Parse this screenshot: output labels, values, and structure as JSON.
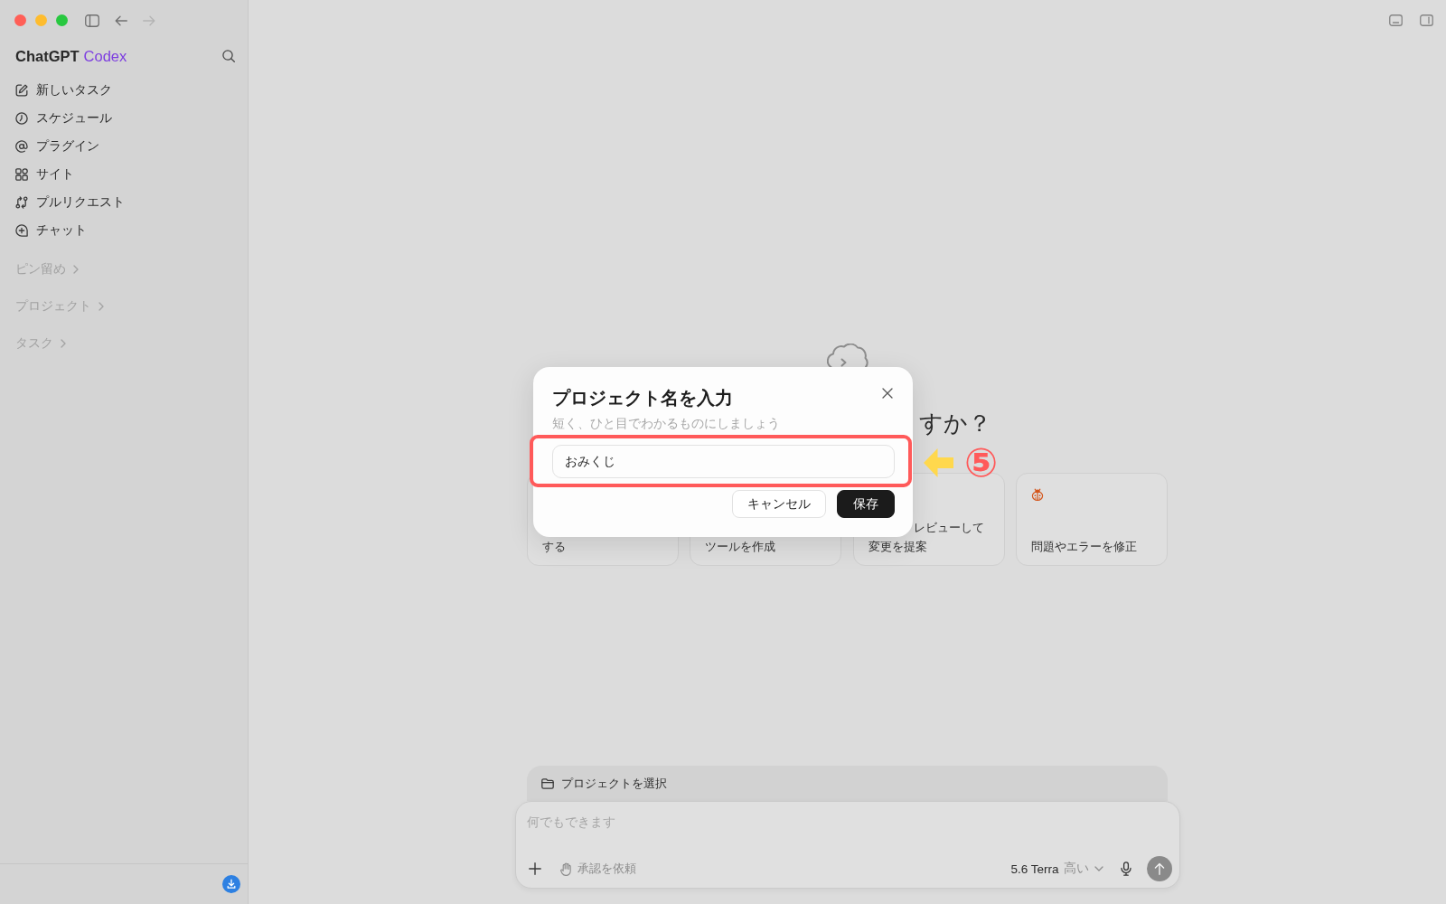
{
  "window": {
    "nav_buttons": [
      {
        "kind": "sidebar-toggle",
        "disabled": false
      },
      {
        "kind": "back",
        "disabled": false
      },
      {
        "kind": "forward",
        "disabled": true
      }
    ]
  },
  "sidebar": {
    "brand": {
      "name": "ChatGPT",
      "product": "Codex"
    },
    "items": [
      {
        "label": "新しいタスク",
        "kind": "new-task",
        "selected": false
      },
      {
        "label": "スケジュール",
        "kind": "schedule",
        "selected": false
      },
      {
        "label": "プラグイン",
        "kind": "plugins",
        "selected": false
      },
      {
        "label": "サイト",
        "kind": "sites",
        "selected": false
      },
      {
        "label": "プルリクエスト",
        "kind": "pull-requests",
        "selected": false
      },
      {
        "label": "チャット",
        "kind": "chat",
        "selected": false
      }
    ],
    "sections": [
      {
        "label": "ピン留め",
        "expanded": false
      },
      {
        "label": "プロジェクト",
        "expanded": false
      },
      {
        "label": "タスク",
        "expanded": false
      }
    ]
  },
  "main": {
    "heading": "すか？",
    "cards": [
      {
        "kind": "plain",
        "lines": [
          {
            "text": "する",
            "kind": "full"
          }
        ]
      },
      {
        "kind": "plain",
        "lines": [
          {
            "text": "ツールを作成",
            "kind": "full"
          }
        ]
      },
      {
        "kind": "plain",
        "lines": [
          {
            "text": "レビューして",
            "kind": "partial"
          },
          {
            "text": "変更を提案",
            "kind": "full"
          }
        ]
      },
      {
        "kind": "bug",
        "lines": [
          {
            "text": "問題やエラーを修正",
            "kind": "full"
          }
        ]
      }
    ]
  },
  "dialog": {
    "title": "プロジェクト名を入力",
    "subtitle": "短く、ひと目でわかるものにしましょう",
    "input": {
      "value": "おみくじ"
    },
    "buttons": [
      {
        "label": "キャンセル",
        "kind": "secondary"
      },
      {
        "label": "保存",
        "kind": "primary"
      }
    ]
  },
  "annotation": {
    "step": "⑤"
  },
  "composer": {
    "project_picker": {
      "label": "プロジェクトを選択"
    },
    "placeholder": "何でもできます",
    "approval": {
      "label": "承認を依頼"
    },
    "model": {
      "name": "5.6 Terra",
      "effort": "高い"
    }
  }
}
